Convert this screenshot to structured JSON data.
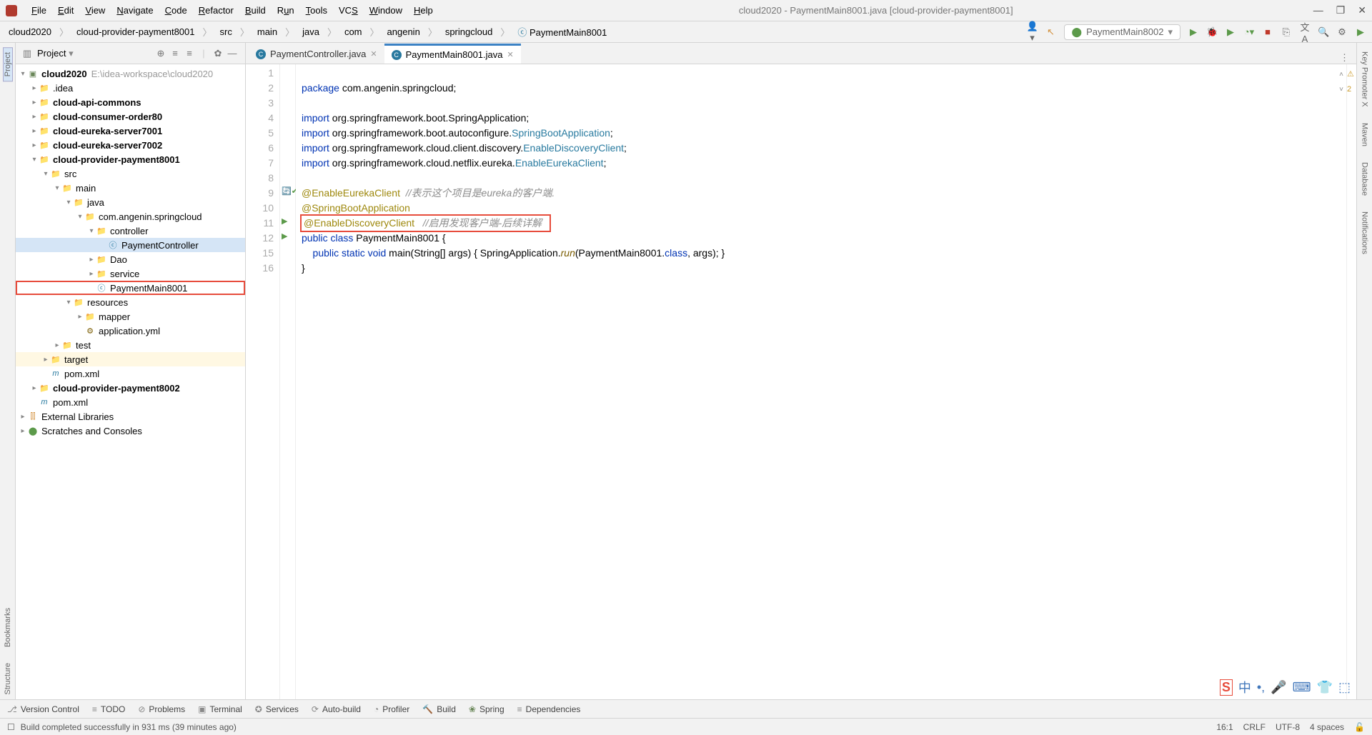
{
  "window": {
    "title": "cloud2020 - PaymentMain8001.java [cloud-provider-payment8001]"
  },
  "menu": [
    "File",
    "Edit",
    "View",
    "Navigate",
    "Code",
    "Refactor",
    "Build",
    "Run",
    "Tools",
    "VCS",
    "Window",
    "Help"
  ],
  "breadcrumbs": [
    "cloud2020",
    "cloud-provider-payment8001",
    "src",
    "main",
    "java",
    "com",
    "angenin",
    "springcloud",
    "PaymentMain8001"
  ],
  "runConfig": "PaymentMain8002",
  "projectPanel": {
    "title": "Project"
  },
  "tree": {
    "root": "cloud2020",
    "rootHint": "E:\\idea-workspace\\cloud2020",
    "items": [
      ".idea",
      "cloud-api-commons",
      "cloud-consumer-order80",
      "cloud-eureka-server7001",
      "cloud-eureka-server7002",
      "cloud-provider-payment8001",
      "src",
      "main",
      "java",
      "com.angenin.springcloud",
      "controller",
      "PaymentController",
      "Dao",
      "service",
      "PaymentMain8001",
      "resources",
      "mapper",
      "application.yml",
      "test",
      "target",
      "pom.xml",
      "cloud-provider-payment8002",
      "pom.xml",
      "External Libraries",
      "Scratches and Consoles"
    ]
  },
  "tabs": [
    {
      "name": "PaymentController.java",
      "active": false
    },
    {
      "name": "PaymentMain8001.java",
      "active": true
    }
  ],
  "code": {
    "l1": {
      "a": "package",
      "b": " com.angenin.springcloud;"
    },
    "l3": {
      "a": "import",
      "b": " org.springframework.boot.SpringApplication;"
    },
    "l4": {
      "a": "import",
      "b": " org.springframework.boot.autoconfigure.",
      "c": "SpringBootApplication",
      "d": ";"
    },
    "l5": {
      "a": "import",
      "b": " org.springframework.cloud.client.discovery.",
      "c": "EnableDiscoveryClient",
      "d": ";"
    },
    "l6": {
      "a": "import",
      "b": " org.springframework.cloud.netflix.eureka.",
      "c": "EnableEurekaClient",
      "d": ";"
    },
    "l8": {
      "a": "@EnableEurekaClient",
      "b": "  //表示这个项目是eureka的客户端."
    },
    "l9": {
      "a": "@SpringBootApplication"
    },
    "l10": {
      "a": "@EnableDiscoveryClient",
      "b": "   //启用发现客户端-后续详解"
    },
    "l11": {
      "a": "public class ",
      "b": "PaymentMain8001",
      " c": " {"
    },
    "l12": {
      "a": "    public static void ",
      "b": "main",
      "c": "(String[] args) { SpringApplication.",
      "d": "run",
      "e": "(PaymentMain8001.",
      "f": "class",
      "g": ", args); }"
    },
    "l15": "}"
  },
  "warnCount": "2",
  "bottomTools": [
    "Version Control",
    "TODO",
    "Problems",
    "Terminal",
    "Services",
    "Auto-build",
    "Profiler",
    "Build",
    "Spring",
    "Dependencies"
  ],
  "status": {
    "msg": "Build completed successfully in 931 ms (39 minutes ago)",
    "pos": "16:1",
    "crlf": "CRLF",
    "enc": "UTF-8",
    "indent": "4 spaces"
  },
  "leftTools": [
    "Bookmarks",
    "Structure"
  ],
  "rightTools": [
    "Key Promoter X",
    "Maven",
    "Database",
    "Notifications"
  ],
  "sideProject": "Project"
}
